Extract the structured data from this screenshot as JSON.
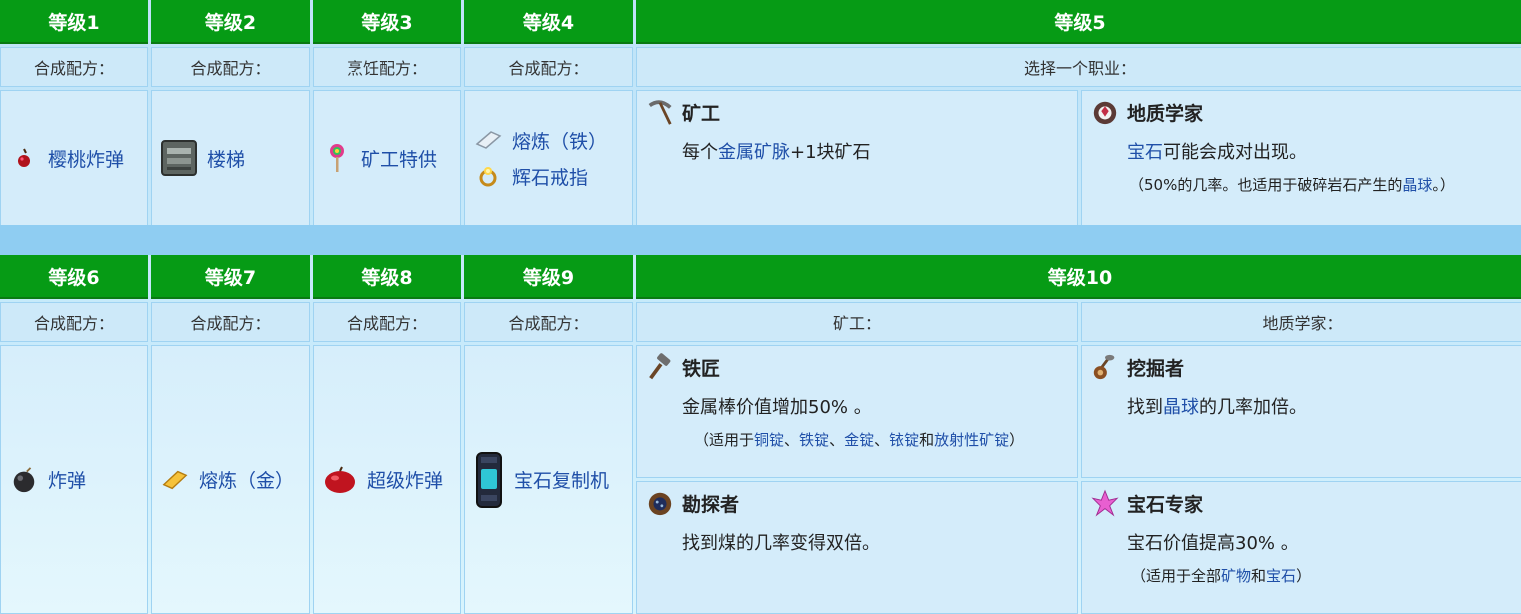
{
  "top": {
    "levels": [
      "等级1",
      "等级2",
      "等级3",
      "等级4",
      "等级5"
    ],
    "subs": [
      "合成配方：",
      "合成配方：",
      "烹饪配方：",
      "合成配方：",
      "选择一个职业："
    ],
    "items": {
      "l1": "樱桃炸弹",
      "l2": "楼梯",
      "l3": "矿工特供",
      "l4a": "熔炼（铁）",
      "l4b": "辉石戒指"
    },
    "miner": {
      "title": "矿工",
      "desc_pre": "每个",
      "desc_link": "金属矿脉",
      "desc_post": "+1块矿石"
    },
    "geologist": {
      "title": "地质学家",
      "desc_link": "宝石",
      "desc_post": "可能会成对出现。",
      "note_pre": "（50%的几率。也适用于破碎岩石产生的",
      "note_link": "晶球",
      "note_post": "。）"
    }
  },
  "bottom": {
    "levels": [
      "等级6",
      "等级7",
      "等级8",
      "等级9",
      "等级10"
    ],
    "subs": [
      "合成配方：",
      "合成配方：",
      "合成配方：",
      "合成配方：",
      "矿工：",
      "地质学家："
    ],
    "items": {
      "l6": "炸弹",
      "l7": "熔炼（金）",
      "l8": "超级炸弹",
      "l9": "宝石复制机"
    },
    "blacksmith": {
      "title": "铁匠",
      "desc": "金属棒价值增加50% 。",
      "note_pre": "（适用于",
      "note_l1": "铜锭",
      "sep1": "、",
      "note_l2": "铁锭",
      "sep2": "、",
      "note_l3": "金锭",
      "sep3": "、",
      "note_l4": "铱锭",
      "and": "和",
      "note_l5": "放射性矿锭",
      "note_post": "）"
    },
    "excavator": {
      "title": "挖掘者",
      "desc_pre": "找到",
      "desc_link": "晶球",
      "desc_post": "的几率加倍。"
    },
    "prospector": {
      "title": "勘探者",
      "desc": "找到煤的几率变得双倍。"
    },
    "gemologist": {
      "title": "宝石专家",
      "desc": "宝石价值提高30% 。",
      "note_pre": "（适用于全部",
      "note_l1": "矿物",
      "and": "和",
      "note_l2": "宝石",
      "note_post": "）"
    }
  },
  "colors": {
    "header_green": "#069b15",
    "link_blue": "#1f4fa8",
    "band_blue": "#8fcdf2"
  },
  "icons": [
    "cherry-bomb-icon",
    "staircase-icon",
    "miner-treat-icon",
    "iron-bar-icon",
    "glowstone-ring-icon",
    "pickaxe-icon",
    "geode-icon",
    "bomb-icon",
    "gold-bar-icon",
    "mega-bomb-icon",
    "crystalarium-icon",
    "hammer-icon",
    "excavator-icon",
    "prospector-icon",
    "gem-icon"
  ]
}
